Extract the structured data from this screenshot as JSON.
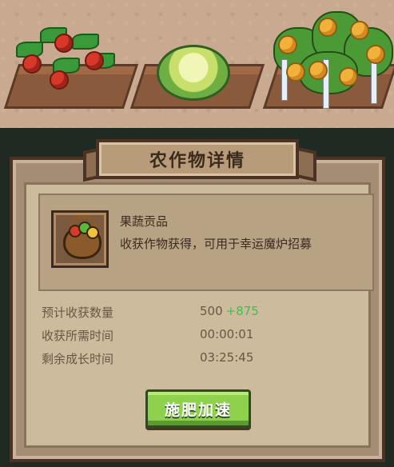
{
  "panel": {
    "title": "农作物详情"
  },
  "item": {
    "icon": "fruit-basket-icon",
    "name": "果蔬贡品",
    "description": "收获作物获得，可用于幸运魔炉招募"
  },
  "stats": [
    {
      "label": "预计收获数量",
      "value": "500",
      "bonus": "+875"
    },
    {
      "label": "收获所需时间",
      "value": "00:00:01"
    },
    {
      "label": "剩余成长时间",
      "value": "03:25:45"
    }
  ],
  "actions": {
    "fertilize_label": "施肥加速"
  },
  "colors": {
    "bonus_green": "#3dc24a",
    "button_green": "#8ed14c",
    "panel_brown": "#a48d74"
  }
}
